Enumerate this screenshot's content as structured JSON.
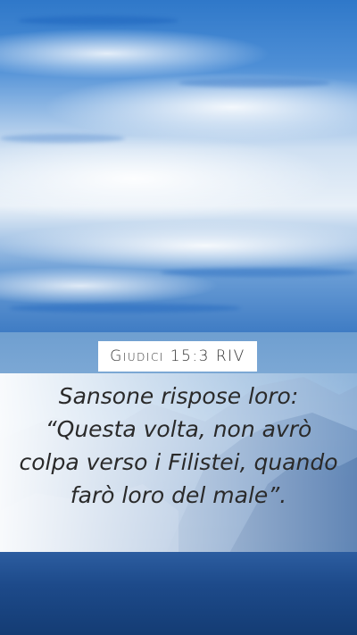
{
  "reference": "Giudici 15:3 RIV",
  "verse": "Sansone rispose loro: “Questa volta, non avrò colpa verso i Filistei, quando farò loro del male”."
}
